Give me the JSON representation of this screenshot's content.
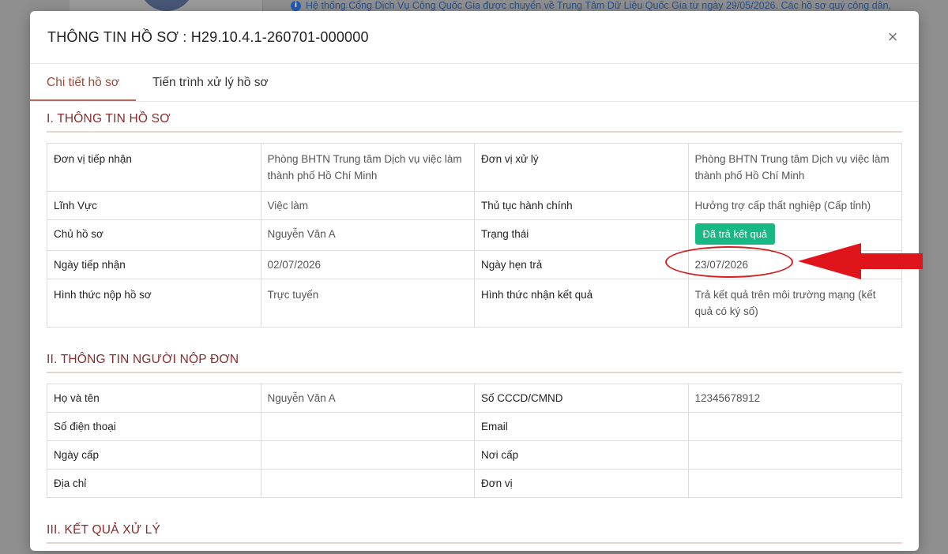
{
  "background": {
    "notice": "Hệ thống Cổng Dịch Vụ Công Quốc Gia được chuyển về Trung Tâm Dữ Liệu Quốc Gia từ ngày 29/05/2026. Các hồ sơ quý công dân,"
  },
  "modal": {
    "title": "THÔNG TIN HỒ SƠ : H29.10.4.1-260701-000000",
    "close": "×",
    "tabs": [
      {
        "label": "Chi tiết hồ sơ",
        "active": true
      },
      {
        "label": "Tiến trình xử lý hồ sơ",
        "active": false
      }
    ]
  },
  "section1": {
    "title": "I. THÔNG TIN HỒ SƠ",
    "rows": [
      {
        "l1": "Đơn vị tiếp nhận",
        "v1": "Phòng BHTN Trung tâm Dịch vụ việc làm thành phố Hồ Chí Minh",
        "l2": "Đơn vị xử lý",
        "v2": "Phòng BHTN Trung tâm Dịch vụ việc làm thành phố Hồ Chí Minh"
      },
      {
        "l1": "Lĩnh Vực",
        "v1": "Việc làm",
        "l2": "Thủ tục hành chính",
        "v2": "Hưởng trợ cấp thất nghiệp (Cấp tỉnh)"
      },
      {
        "l1": "Chủ hồ sơ",
        "v1": "Nguyễn Văn A",
        "l2": "Trạng thái",
        "v2": "Đã trả kết quả"
      },
      {
        "l1": "Ngày tiếp nhận",
        "v1": "02/07/2026",
        "l2": "Ngày hẹn trả",
        "v2": "23/07/2026"
      },
      {
        "l1": "Hình thức nộp hồ sơ",
        "v1": "Trực tuyến",
        "l2": "Hình thức nhận kết quả",
        "v2": "Trả kết quả trên môi trường mạng (kết quả có ký số)"
      }
    ]
  },
  "section2": {
    "title": "II. THÔNG TIN NGƯỜI NỘP ĐƠN",
    "rows": [
      {
        "l1": "Họ và tên",
        "v1": "Nguyễn Văn A",
        "l2": "Số CCCD/CMND",
        "v2": "12345678912"
      },
      {
        "l1": "Số điện thoại",
        "v1": "",
        "l2": "Email",
        "v2": ""
      },
      {
        "l1": "Ngày cấp",
        "v1": "",
        "l2": "Nơi cấp",
        "v2": ""
      },
      {
        "l1": "Địa chỉ",
        "v1": "",
        "l2": "Đơn vị",
        "v2": ""
      }
    ]
  },
  "section3": {
    "title": "III. KẾT QUẢ XỬ LÝ"
  },
  "colors": {
    "status_badge": "#17b883",
    "section_title": "#8a2a2a",
    "annotation": "#e0141b"
  }
}
